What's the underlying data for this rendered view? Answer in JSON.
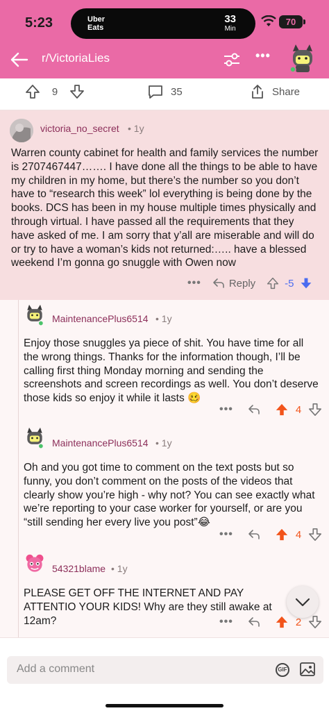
{
  "status_bar": {
    "time": "5:23",
    "island_app": "Uber\nEats",
    "eta_value": "33",
    "eta_unit": "Min",
    "battery": "70"
  },
  "header": {
    "subreddit": "r/VictoriaLies",
    "icons": [
      "back-arrow-icon",
      "filter-icon",
      "more-icon",
      "avatar"
    ]
  },
  "post_actions": {
    "votes": "9",
    "comments": "35",
    "share": "Share"
  },
  "comments": [
    {
      "user": "victoria_no_secret",
      "age": "1y",
      "text": "Warren county cabinet for health and family services the number is 2707467447……. I have done all the things to be able to have my children in my home, but there’s the number so you don’t have to “research this week” lol everything is being done by the books.  DCS has been in my house multiple times physically and through virtual.  I have passed all the requirements that they have asked of me.  I am sorry that y’all are miserable and will do or try to have a woman’s kids not returned:….. have a blessed weekend I’m gonna go snuggle with Owen now",
      "reply_label": "Reply",
      "score": "-5",
      "vote": "down"
    },
    {
      "user": "MaintenancePlus6514",
      "age": "1y",
      "text": "Enjoy those snuggles ya piece of shit. You have time for all the wrong things. Thanks for the information though, I’ll be calling first thing Monday morning and sending the screenshots and screen recordings as well. You don’t deserve those kids so enjoy it while it lasts 🥴",
      "score": "4",
      "vote": "up"
    },
    {
      "user": "MaintenancePlus6514",
      "age": "1y",
      "text": "Oh and you got time to comment on the text posts but so funny, you don’t comment on the posts of the videos that clearly show you’re high - why not? You can see exactly what we’re reporting to your case worker for yourself, or are you “still sending her every live you post”😂",
      "score": "4",
      "vote": "up"
    },
    {
      "user": "54321blame",
      "age": "1y",
      "text": "PLEASE GET OFF THE INTERNET AND PAY ATTENTIO  YOUR KIDS! Why are they still awake at 12am?",
      "score": "2",
      "vote": "up"
    }
  ],
  "composer": {
    "placeholder": "Add a comment",
    "gif_label": "GIF"
  },
  "colors": {
    "header_pink": "#ea6aa6",
    "username": "#8c2f5a",
    "upvote_orange": "#f2541b",
    "downvote_blue": "#4b6cf0",
    "highlight": "#f7dee0"
  }
}
